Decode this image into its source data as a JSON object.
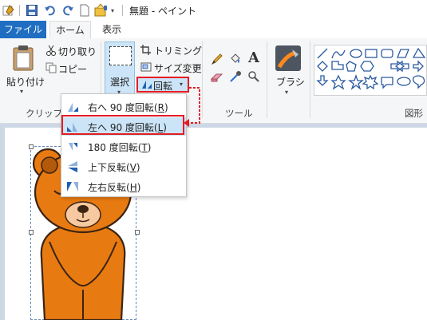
{
  "window": {
    "title": "無題 - ペイント"
  },
  "tabs": [
    {
      "label": "ファイル"
    },
    {
      "label": "ホーム"
    },
    {
      "label": "表示"
    }
  ],
  "clipboard": {
    "paste_label": "貼り付け",
    "cut_label": "切り取り",
    "copy_label": "コピー",
    "group_label": "クリップボ"
  },
  "image": {
    "select_label": "選択",
    "crop_label": "トリミング",
    "resize_label": "サイズ変更",
    "rotate_label": "回転"
  },
  "tools": {
    "group_label": "ツール"
  },
  "brushes": {
    "label": "ブラシ"
  },
  "shapes": {
    "group_label": "図形"
  },
  "rotate_menu": {
    "items": [
      {
        "text": "右へ 90 度回転(",
        "key": "R",
        "close": ")"
      },
      {
        "text": "左へ 90 度回転(",
        "key": "L",
        "close": ")"
      },
      {
        "text": "180 度回転(",
        "key": "T",
        "close": ")"
      },
      {
        "text": "上下反転(",
        "key": "V",
        "close": ")"
      },
      {
        "text": "左右反転(",
        "key": "H",
        "close": ")"
      }
    ],
    "highlighted_index": 1
  },
  "colors": {
    "accent": "#1f6ec2",
    "highlight": "#e51c23",
    "bear": "#e87a12",
    "bear_outline": "#3b2412",
    "canvas_bg": "#cdd8e7"
  }
}
